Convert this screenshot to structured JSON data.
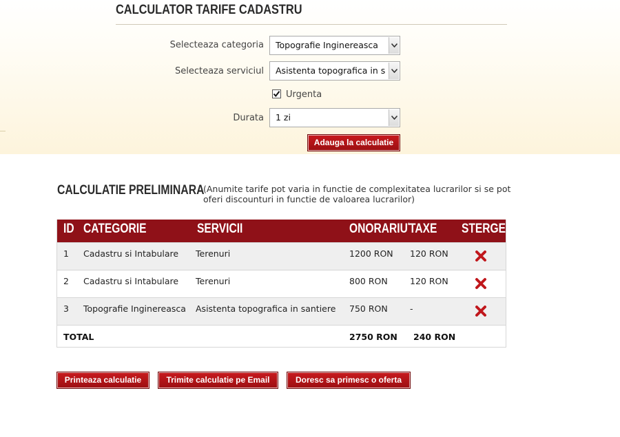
{
  "calculator": {
    "title": "CALCULATOR TARIFE CADASTRU",
    "category_label": "Selecteaza categoria",
    "category_value": "Topografie Inginereasca",
    "service_label": "Selecteaza serviciul",
    "service_value": "Asistenta topografica in santiere",
    "urgent_label": "Urgenta",
    "urgent_checked": true,
    "duration_label": "Durata",
    "duration_value": "1 zi",
    "add_button": "Adauga la calculatie"
  },
  "preliminary": {
    "title": "CALCULATIE PRELIMINARA",
    "note": "(Anumite tarife pot varia in functie de complexitatea lucrarilor si se pot oferi discounturi in functie de valoarea lucrarilor)"
  },
  "table": {
    "headers": {
      "id": "ID",
      "category": "CATEGORIE",
      "services": "SERVICII",
      "fee": "ONORARIU",
      "fee_mark": "*",
      "tax": "TAXE",
      "delete": "STERGE"
    },
    "rows": [
      {
        "id": "1",
        "category": "Cadastru si Intabulare",
        "service": "Terenuri",
        "fee": "1200 RON",
        "tax": "120 RON"
      },
      {
        "id": "2",
        "category": "Cadastru si Intabulare",
        "service": "Terenuri",
        "fee": "800 RON",
        "tax": "120 RON"
      },
      {
        "id": "3",
        "category": "Topografie Inginereasca",
        "service": "Asistenta topografica in santiere",
        "fee": "750 RON",
        "tax": "-"
      }
    ],
    "total": {
      "label": "TOTAL",
      "fee": "2750 RON",
      "tax": "240 RON"
    }
  },
  "actions": {
    "print": "Printeaza calculatie",
    "email": "Trimite calculatie pe Email",
    "offer": "Doresc sa primesc o oferta"
  },
  "colors": {
    "header_bg": "#8f1118",
    "button_red": "#b5151a",
    "delete_icon": "#c0171c"
  }
}
